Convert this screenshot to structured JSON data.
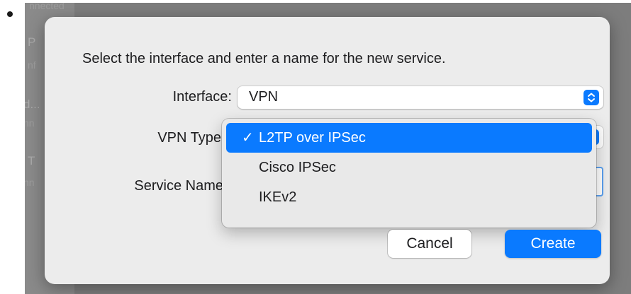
{
  "background": {
    "items": [
      {
        "text": "nnected"
      },
      {
        "text": "P"
      },
      {
        "text": "nf"
      },
      {
        "text": "d..."
      },
      {
        "text": "nn"
      },
      {
        "text": "T"
      },
      {
        "text": "nn"
      }
    ]
  },
  "dialog": {
    "prompt": "Select the interface and enter a name for the new service.",
    "interface_label": "Interface:",
    "interface_value": "VPN",
    "vpn_type_label": "VPN Type",
    "service_name_label": "Service Name",
    "vpn_type_menu": {
      "checkmark": "✓",
      "items": [
        {
          "label": "L2TP over IPSec",
          "selected": true
        },
        {
          "label": "Cisco IPSec",
          "selected": false
        },
        {
          "label": "IKEv2",
          "selected": false
        }
      ]
    },
    "cancel_label": "Cancel",
    "create_label": "Create"
  },
  "colors": {
    "accent": "#0a7aff",
    "dialog_bg": "#ececec",
    "backdrop": "#7d7d7d"
  },
  "icons": {
    "popup_stepper": "chevron-up-down-icon",
    "checkmark": "checkmark-icon"
  }
}
